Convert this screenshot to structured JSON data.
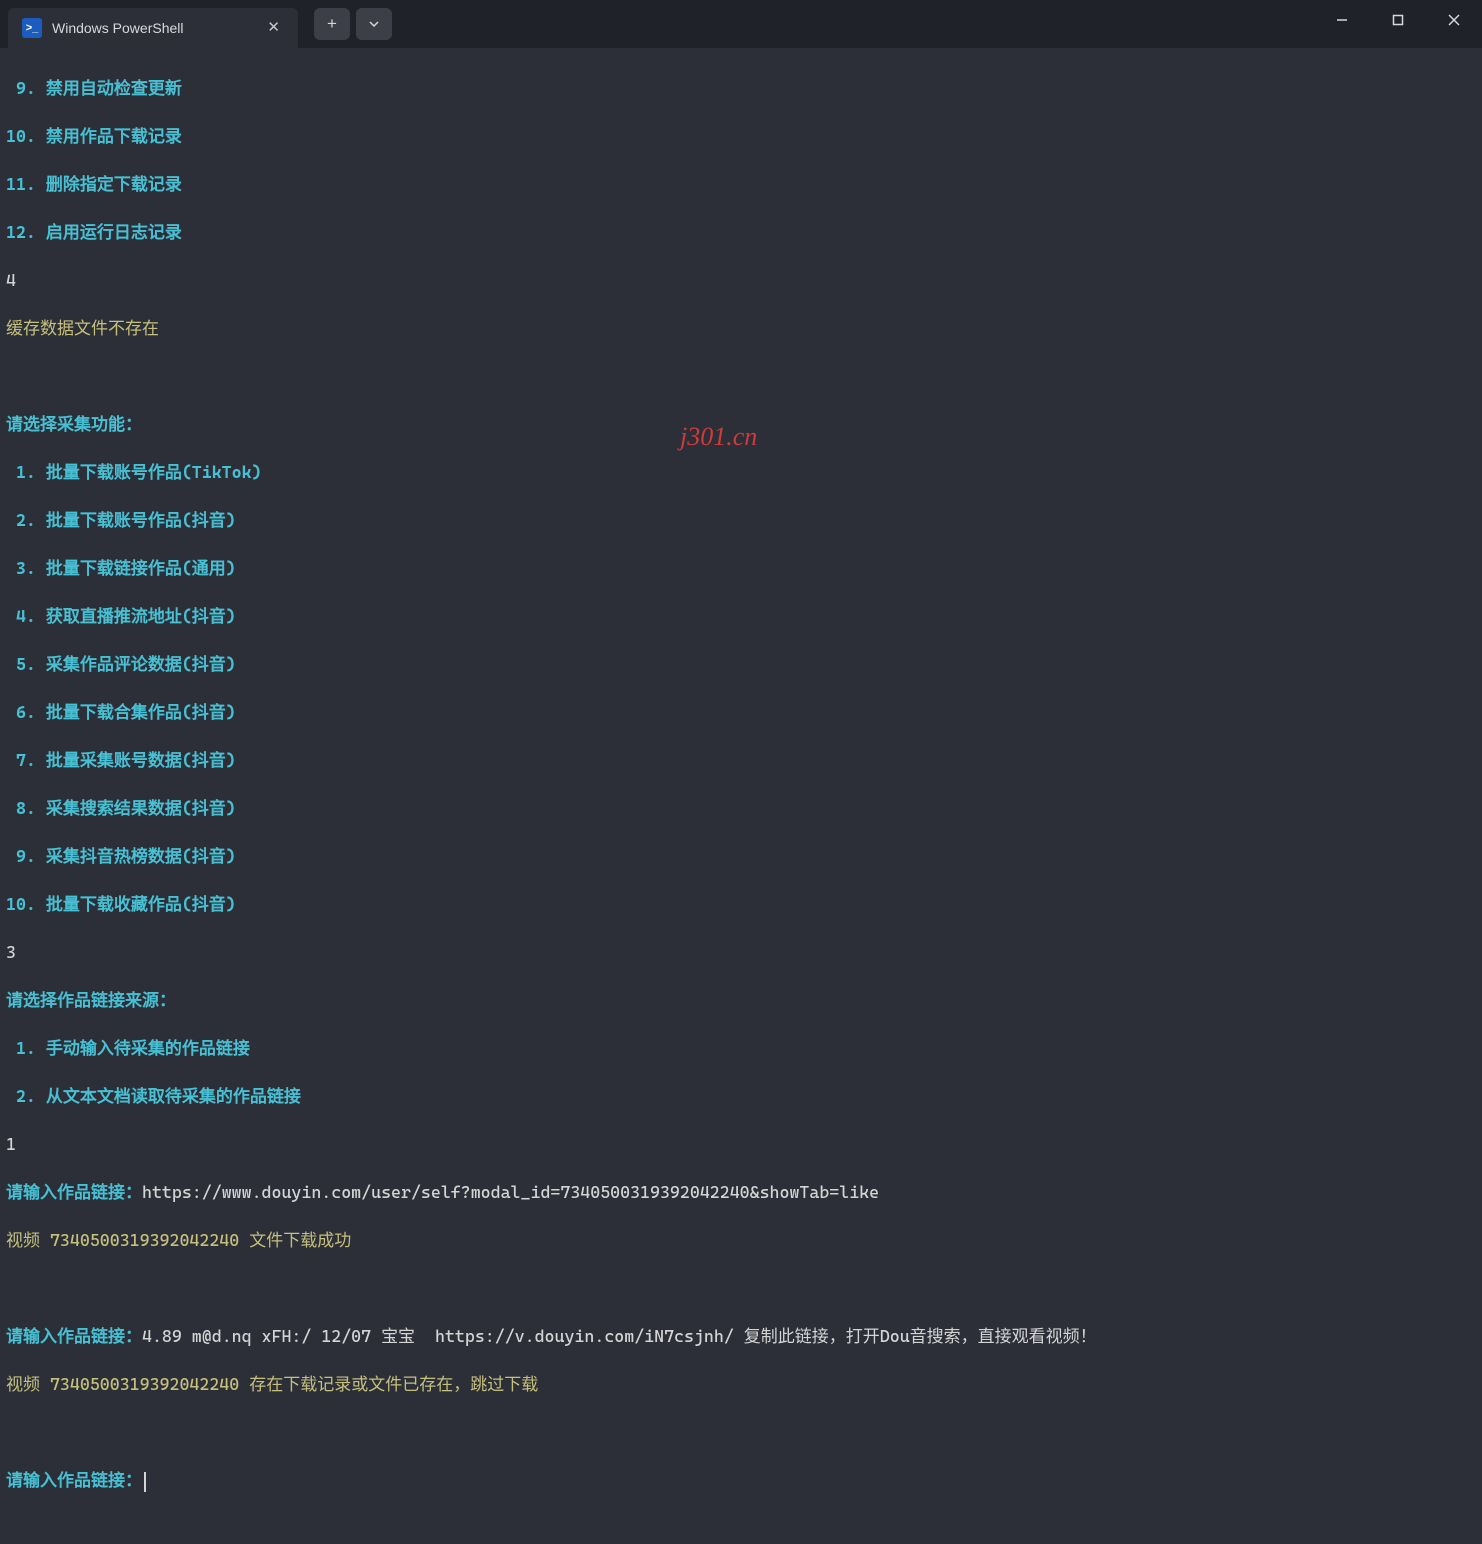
{
  "titlebar": {
    "tab_title": "Windows PowerShell",
    "ps_badge": ">_"
  },
  "menu_top": [
    " 9. 禁用自动检查更新",
    "10. 禁用作品下载记录",
    "11. 删除指定下载记录",
    "12. 启用运行日志记录"
  ],
  "input_after_menu": "4",
  "cache_msg": "缓存数据文件不存在",
  "collect_prompt": "请选择采集功能：",
  "collect_menu": [
    " 1. 批量下载账号作品(TikTok)",
    " 2. 批量下载账号作品(抖音)",
    " 3. 批量下载链接作品(通用)",
    " 4. 获取直播推流地址(抖音)",
    " 5. 采集作品评论数据(抖音)",
    " 6. 批量下载合集作品(抖音)",
    " 7. 批量采集账号数据(抖音)",
    " 8. 采集搜索结果数据(抖音)",
    " 9. 采集抖音热榜数据(抖音)",
    "10. 批量下载收藏作品(抖音)"
  ],
  "input_after_collect": "3",
  "source_prompt": "请选择作品链接来源：",
  "source_menu": [
    " 1. 手动输入待采集的作品链接",
    " 2. 从文本文档读取待采集的作品链接"
  ],
  "input_after_source": "1",
  "link1": {
    "prompt": "请输入作品链接：",
    "value": "https://www.douyin.com/user/self?modal_id=7340500319392042240&showTab=like",
    "result_prefix": "视频 ",
    "result_id": "7340500319392042240",
    "result_suffix": " 文件下载成功"
  },
  "link2": {
    "prompt": "请输入作品链接：",
    "value": "4.89 m@d.nq xFH:/ 12/07 宝宝  https://v.douyin.com/iN7csjnh/ 复制此链接，打开Dou音搜索，直接观看视频！",
    "result_prefix": "视频 ",
    "result_id": "7340500319392042240",
    "result_suffix": " 存在下载记录或文件已存在，跳过下载"
  },
  "link3_prompt": "请输入作品链接：",
  "watermark": "j301.cn"
}
